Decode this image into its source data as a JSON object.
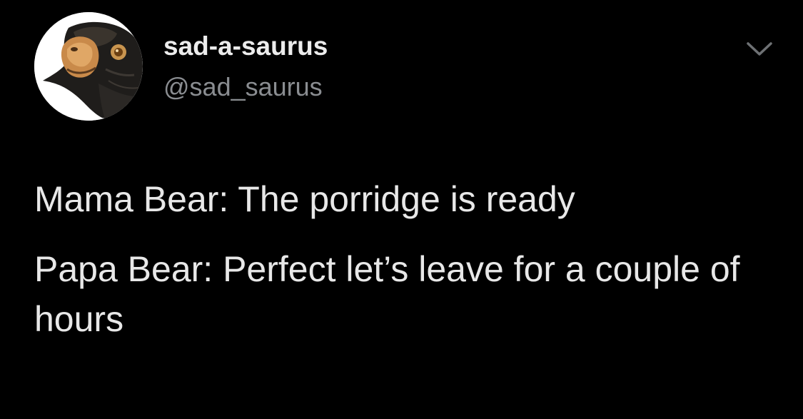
{
  "user": {
    "display_name": "sad-a-saurus",
    "handle": "@sad_saurus",
    "avatar_icon": "dinosaur-avatar"
  },
  "menu": {
    "icon": "chevron-down-icon"
  },
  "tweet": {
    "lines": [
      "Mama Bear: The porridge is ready",
      "Papa Bear: Perfect let’s leave for a couple of hours"
    ]
  },
  "colors": {
    "background": "#000000",
    "text": "#e8e8e8",
    "handle": "#8a8d91",
    "chevron": "#6e7174"
  }
}
